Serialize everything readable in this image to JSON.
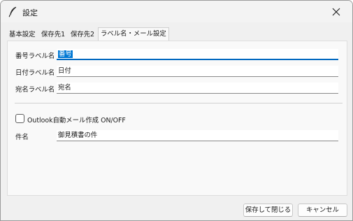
{
  "window": {
    "title": "設定"
  },
  "tabs": [
    {
      "label": "基本設定",
      "active": false
    },
    {
      "label": "保存先1",
      "active": false
    },
    {
      "label": "保存先2",
      "active": false
    },
    {
      "label": "ラベル名・メール設定",
      "active": true
    }
  ],
  "labels_section": {
    "fields": [
      {
        "label": "番号ラベル名",
        "value": "番号"
      },
      {
        "label": "日付ラベル名",
        "value": "日付"
      },
      {
        "label": "宛名ラベル名",
        "value": "宛名"
      }
    ]
  },
  "mail_section": {
    "outlook_toggle_label": "Outlook自動メール作成 ON/OFF",
    "outlook_checked": false,
    "subject_label": "件名",
    "subject_value": "御見積書の件"
  },
  "buttons": {
    "save_close": "保存して閉じる",
    "cancel": "キャンセル"
  }
}
